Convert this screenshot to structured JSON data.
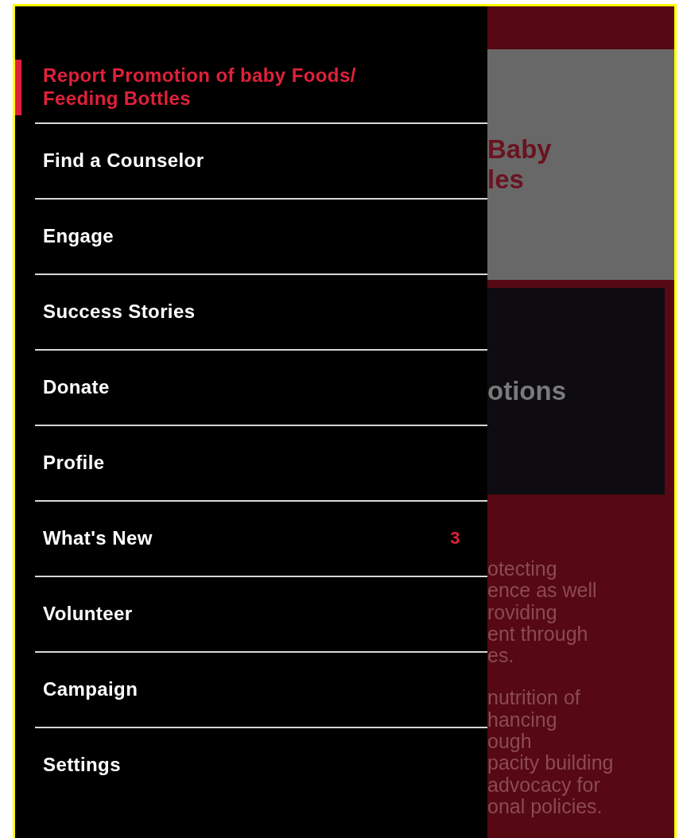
{
  "drawer": {
    "items": [
      {
        "label": "Report Promotion of baby Foods/ Feeding Bottles",
        "selected": true
      },
      {
        "label": "Find a Counselor",
        "selected": false
      },
      {
        "label": "Engage",
        "selected": false
      },
      {
        "label": "Success Stories",
        "selected": false
      },
      {
        "label": "Donate",
        "selected": false
      },
      {
        "label": "Profile",
        "selected": false
      },
      {
        "label": "What's New",
        "selected": false,
        "badge": "3"
      },
      {
        "label": "Volunteer",
        "selected": false
      },
      {
        "label": "Campaign",
        "selected": false
      },
      {
        "label": "Settings",
        "selected": false
      }
    ]
  },
  "background": {
    "banner_title_lines": [
      "Baby",
      "les"
    ],
    "card_title": "otions",
    "paragraphs": [
      [
        "otecting",
        "ence as well",
        "roviding",
        "ent through",
        "es."
      ],
      [
        "nutrition of",
        "hancing",
        "ough",
        "pacity building",
        "advocacy for",
        "onal policies."
      ]
    ]
  }
}
